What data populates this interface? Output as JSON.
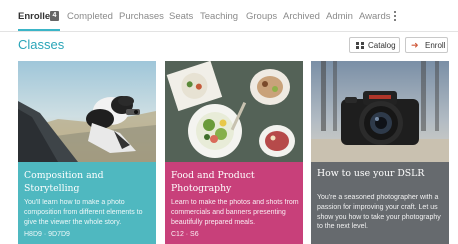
{
  "tabs": {
    "items": [
      {
        "label": "Enrolled"
      },
      {
        "label": "Completed"
      },
      {
        "label": "Purchases"
      },
      {
        "label": "Seats"
      },
      {
        "label": "Teaching"
      },
      {
        "label": "Groups"
      },
      {
        "label": "Archived"
      },
      {
        "label": "Admin"
      },
      {
        "label": "Awards"
      }
    ],
    "active": "Enrolled",
    "enrolled_count": "4"
  },
  "header": {
    "title": "Classes",
    "catalog_label": "Catalog",
    "enroll_label": "Enroll"
  },
  "cards": [
    {
      "title": "Composition and Storytelling",
      "description": "You'll learn how to make a photo composition from different elements to give the viewer the whole story.",
      "code": "H8D9 · 9D7D9",
      "color": "#4fb8c0"
    },
    {
      "title": "Food and Product Photography",
      "description": "Learn to make the photos and shots from commercials and banners presenting beautifully prepared meals.",
      "code": "C12 · S6",
      "color": "#c8407a"
    },
    {
      "title": "How to use your DSLR",
      "description": "You're a seasoned photographer with a passion for improving your craft. Let us show you how to take your photography to the next level.",
      "code": "",
      "color": "#666a6e"
    }
  ],
  "colors": {
    "accent": "#3bb5c7",
    "enroll_arrow": "#d05b3d"
  }
}
